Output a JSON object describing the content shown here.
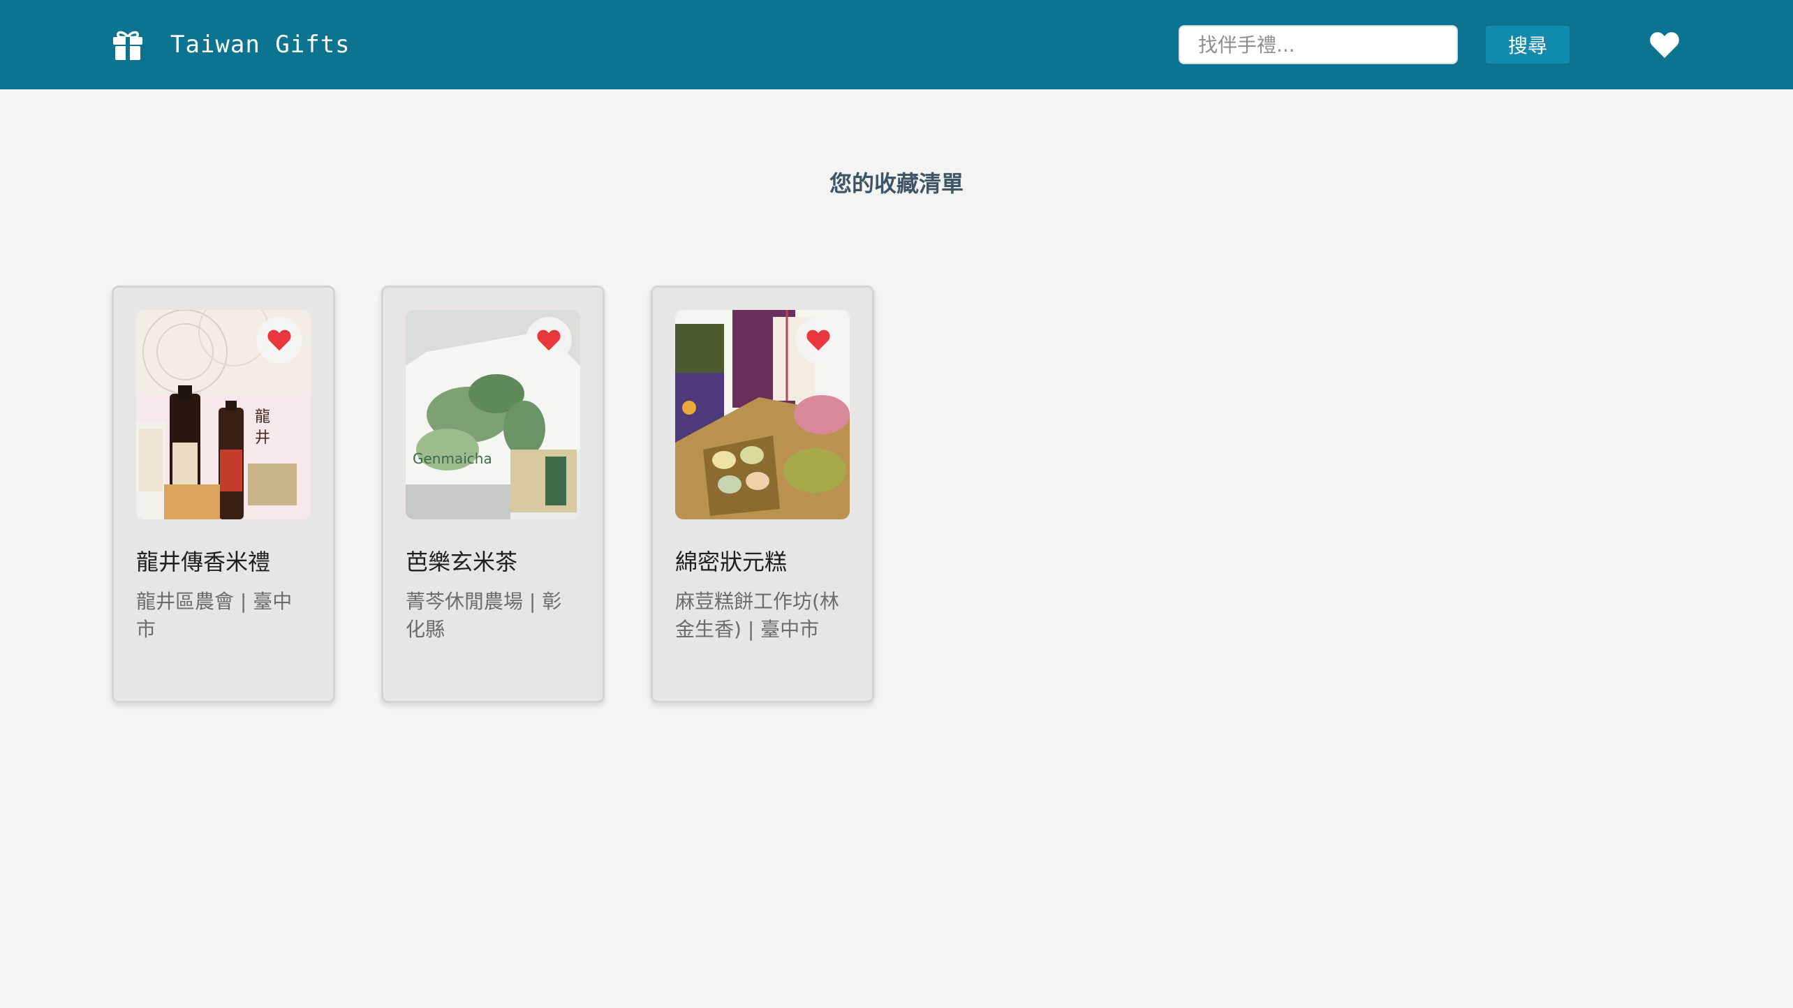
{
  "navbar": {
    "brand_name": "Taiwan Gifts",
    "brand_icon": "gift-icon",
    "search_placeholder": "找伴手禮...",
    "search_button_label": "搜尋",
    "favorites_icon": "heart-icon",
    "background_color": "#0c7391"
  },
  "page": {
    "title": "您的收藏清單"
  },
  "favorites": [
    {
      "title": "龍井傳香米禮",
      "meta": "龍井區農會 | 臺中市",
      "favorited": true
    },
    {
      "title": "芭樂玄米茶",
      "meta": "菁芩休閒農場 | 彰化縣",
      "favorited": true
    },
    {
      "title": "綿密狀元糕",
      "meta": "麻荳糕餅工作坊(林金生香) | 臺中市",
      "favorited": true
    }
  ],
  "colors": {
    "heart_active": "#e8383d",
    "button": "#128aab",
    "page_background": "#f4f4f2"
  }
}
